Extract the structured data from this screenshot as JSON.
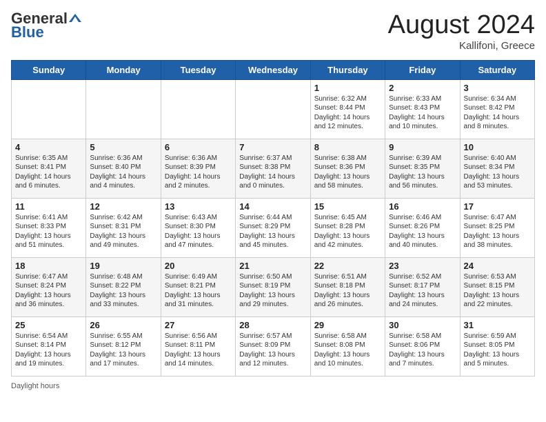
{
  "header": {
    "logo_general": "General",
    "logo_blue": "Blue",
    "month_year": "August 2024",
    "location": "Kallifoni, Greece"
  },
  "days_of_week": [
    "Sunday",
    "Monday",
    "Tuesday",
    "Wednesday",
    "Thursday",
    "Friday",
    "Saturday"
  ],
  "footer": {
    "daylight_hours_label": "Daylight hours"
  },
  "weeks": [
    [
      {
        "day": "",
        "info": ""
      },
      {
        "day": "",
        "info": ""
      },
      {
        "day": "",
        "info": ""
      },
      {
        "day": "",
        "info": ""
      },
      {
        "day": "1",
        "info": "Sunrise: 6:32 AM\nSunset: 8:44 PM\nDaylight: 14 hours\nand 12 minutes."
      },
      {
        "day": "2",
        "info": "Sunrise: 6:33 AM\nSunset: 8:43 PM\nDaylight: 14 hours\nand 10 minutes."
      },
      {
        "day": "3",
        "info": "Sunrise: 6:34 AM\nSunset: 8:42 PM\nDaylight: 14 hours\nand 8 minutes."
      }
    ],
    [
      {
        "day": "4",
        "info": "Sunrise: 6:35 AM\nSunset: 8:41 PM\nDaylight: 14 hours\nand 6 minutes."
      },
      {
        "day": "5",
        "info": "Sunrise: 6:36 AM\nSunset: 8:40 PM\nDaylight: 14 hours\nand 4 minutes."
      },
      {
        "day": "6",
        "info": "Sunrise: 6:36 AM\nSunset: 8:39 PM\nDaylight: 14 hours\nand 2 minutes."
      },
      {
        "day": "7",
        "info": "Sunrise: 6:37 AM\nSunset: 8:38 PM\nDaylight: 14 hours\nand 0 minutes."
      },
      {
        "day": "8",
        "info": "Sunrise: 6:38 AM\nSunset: 8:36 PM\nDaylight: 13 hours\nand 58 minutes."
      },
      {
        "day": "9",
        "info": "Sunrise: 6:39 AM\nSunset: 8:35 PM\nDaylight: 13 hours\nand 56 minutes."
      },
      {
        "day": "10",
        "info": "Sunrise: 6:40 AM\nSunset: 8:34 PM\nDaylight: 13 hours\nand 53 minutes."
      }
    ],
    [
      {
        "day": "11",
        "info": "Sunrise: 6:41 AM\nSunset: 8:33 PM\nDaylight: 13 hours\nand 51 minutes."
      },
      {
        "day": "12",
        "info": "Sunrise: 6:42 AM\nSunset: 8:31 PM\nDaylight: 13 hours\nand 49 minutes."
      },
      {
        "day": "13",
        "info": "Sunrise: 6:43 AM\nSunset: 8:30 PM\nDaylight: 13 hours\nand 47 minutes."
      },
      {
        "day": "14",
        "info": "Sunrise: 6:44 AM\nSunset: 8:29 PM\nDaylight: 13 hours\nand 45 minutes."
      },
      {
        "day": "15",
        "info": "Sunrise: 6:45 AM\nSunset: 8:28 PM\nDaylight: 13 hours\nand 42 minutes."
      },
      {
        "day": "16",
        "info": "Sunrise: 6:46 AM\nSunset: 8:26 PM\nDaylight: 13 hours\nand 40 minutes."
      },
      {
        "day": "17",
        "info": "Sunrise: 6:47 AM\nSunset: 8:25 PM\nDaylight: 13 hours\nand 38 minutes."
      }
    ],
    [
      {
        "day": "18",
        "info": "Sunrise: 6:47 AM\nSunset: 8:24 PM\nDaylight: 13 hours\nand 36 minutes."
      },
      {
        "day": "19",
        "info": "Sunrise: 6:48 AM\nSunset: 8:22 PM\nDaylight: 13 hours\nand 33 minutes."
      },
      {
        "day": "20",
        "info": "Sunrise: 6:49 AM\nSunset: 8:21 PM\nDaylight: 13 hours\nand 31 minutes."
      },
      {
        "day": "21",
        "info": "Sunrise: 6:50 AM\nSunset: 8:19 PM\nDaylight: 13 hours\nand 29 minutes."
      },
      {
        "day": "22",
        "info": "Sunrise: 6:51 AM\nSunset: 8:18 PM\nDaylight: 13 hours\nand 26 minutes."
      },
      {
        "day": "23",
        "info": "Sunrise: 6:52 AM\nSunset: 8:17 PM\nDaylight: 13 hours\nand 24 minutes."
      },
      {
        "day": "24",
        "info": "Sunrise: 6:53 AM\nSunset: 8:15 PM\nDaylight: 13 hours\nand 22 minutes."
      }
    ],
    [
      {
        "day": "25",
        "info": "Sunrise: 6:54 AM\nSunset: 8:14 PM\nDaylight: 13 hours\nand 19 minutes."
      },
      {
        "day": "26",
        "info": "Sunrise: 6:55 AM\nSunset: 8:12 PM\nDaylight: 13 hours\nand 17 minutes."
      },
      {
        "day": "27",
        "info": "Sunrise: 6:56 AM\nSunset: 8:11 PM\nDaylight: 13 hours\nand 14 minutes."
      },
      {
        "day": "28",
        "info": "Sunrise: 6:57 AM\nSunset: 8:09 PM\nDaylight: 13 hours\nand 12 minutes."
      },
      {
        "day": "29",
        "info": "Sunrise: 6:58 AM\nSunset: 8:08 PM\nDaylight: 13 hours\nand 10 minutes."
      },
      {
        "day": "30",
        "info": "Sunrise: 6:58 AM\nSunset: 8:06 PM\nDaylight: 13 hours\nand 7 minutes."
      },
      {
        "day": "31",
        "info": "Sunrise: 6:59 AM\nSunset: 8:05 PM\nDaylight: 13 hours\nand 5 minutes."
      }
    ]
  ]
}
